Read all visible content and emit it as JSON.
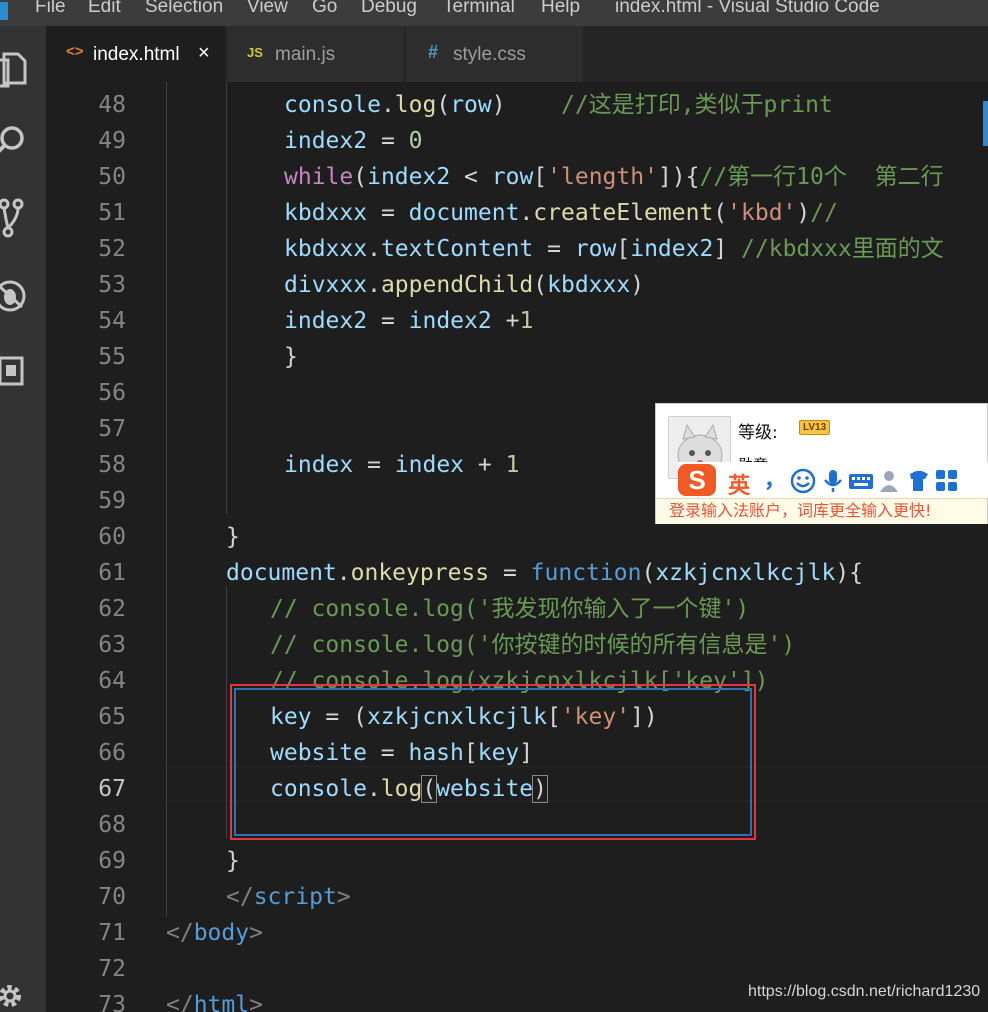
{
  "window": {
    "title": "index.html - Visual Studio Code"
  },
  "menu": [
    "File",
    "Edit",
    "Selection",
    "View",
    "Go",
    "Debug",
    "Terminal",
    "Help"
  ],
  "tabs": [
    {
      "icon": "<>",
      "label": "index.html",
      "close": "×",
      "active": true
    },
    {
      "icon": "JS",
      "label": "main.js",
      "active": false
    },
    {
      "icon": "#",
      "label": "style.css",
      "active": false
    }
  ],
  "current_line": "67",
  "lines": [
    {
      "n": "48",
      "tokens": [
        [
          "console",
          "var"
        ],
        [
          ".",
          "op"
        ],
        [
          "log",
          "fn"
        ],
        [
          "(",
          "op"
        ],
        [
          "row",
          "var"
        ],
        [
          ")",
          "op"
        ],
        [
          "    //这是打印,类似于print",
          "com"
        ]
      ]
    },
    {
      "n": "49",
      "tokens": [
        [
          "index2",
          "var"
        ],
        [
          " = ",
          "op"
        ],
        [
          "0",
          "num"
        ]
      ]
    },
    {
      "n": "50",
      "tokens": [
        [
          "while",
          "kw"
        ],
        [
          "(",
          "op"
        ],
        [
          "index2",
          "var"
        ],
        [
          " < ",
          "op"
        ],
        [
          "row",
          "var"
        ],
        [
          "[",
          "op"
        ],
        [
          "'length'",
          "str"
        ],
        [
          "]){",
          "op"
        ],
        [
          "//第一行10个  第二行",
          "com"
        ]
      ]
    },
    {
      "n": "51",
      "tokens": [
        [
          "kbdxxx",
          "var"
        ],
        [
          " = ",
          "op"
        ],
        [
          "document",
          "var"
        ],
        [
          ".",
          "op"
        ],
        [
          "createElement",
          "fn"
        ],
        [
          "(",
          "op"
        ],
        [
          "'kbd'",
          "str"
        ],
        [
          ")",
          "op"
        ],
        [
          "//",
          "com"
        ]
      ]
    },
    {
      "n": "52",
      "tokens": [
        [
          "kbdxxx",
          "var"
        ],
        [
          ".",
          "op"
        ],
        [
          "textContent",
          "var"
        ],
        [
          " = ",
          "op"
        ],
        [
          "row",
          "var"
        ],
        [
          "[",
          "op"
        ],
        [
          "index2",
          "var"
        ],
        [
          "] ",
          "op"
        ],
        [
          "//kbdxxx里面的文",
          "com"
        ]
      ]
    },
    {
      "n": "53",
      "tokens": [
        [
          "divxxx",
          "var"
        ],
        [
          ".",
          "op"
        ],
        [
          "appendChild",
          "fn"
        ],
        [
          "(",
          "op"
        ],
        [
          "kbdxxx",
          "var"
        ],
        [
          ")",
          "op"
        ]
      ]
    },
    {
      "n": "54",
      "tokens": [
        [
          "index2",
          "var"
        ],
        [
          " = ",
          "op"
        ],
        [
          "index2",
          "var"
        ],
        [
          " +",
          "op"
        ],
        [
          "1",
          "num"
        ]
      ]
    },
    {
      "n": "55",
      "tokens": [
        [
          "}",
          "op"
        ]
      ]
    },
    {
      "n": "56",
      "tokens": []
    },
    {
      "n": "57",
      "tokens": []
    },
    {
      "n": "58",
      "tokens": [
        [
          "index",
          "var"
        ],
        [
          " = ",
          "op"
        ],
        [
          "index",
          "var"
        ],
        [
          " + ",
          "op"
        ],
        [
          "1",
          "num"
        ]
      ]
    },
    {
      "n": "59",
      "tokens": []
    },
    {
      "n": "60",
      "tokens": [
        [
          "}",
          "op"
        ]
      ]
    },
    {
      "n": "61",
      "tokens": [
        [
          "document",
          "var"
        ],
        [
          ".",
          "op"
        ],
        [
          "onkeypress",
          "fn"
        ],
        [
          " = ",
          "op"
        ],
        [
          "function",
          "kw2"
        ],
        [
          "(",
          "op"
        ],
        [
          "xzkjcnxlkcjlk",
          "var"
        ],
        [
          "){",
          "op"
        ]
      ]
    },
    {
      "n": "62",
      "tokens": [
        [
          "// console.log('我发现你输入了一个键')",
          "com"
        ]
      ]
    },
    {
      "n": "63",
      "tokens": [
        [
          "// console.log('你按键的时候的所有信息是')",
          "com"
        ]
      ]
    },
    {
      "n": "64",
      "tokens": [
        [
          "// console.log(xzkjcnxlkcjlk['key'])",
          "com"
        ]
      ]
    },
    {
      "n": "65",
      "tokens": [
        [
          "key",
          "var"
        ],
        [
          " = (",
          "op"
        ],
        [
          "xzkjcnxlkcjlk",
          "var"
        ],
        [
          "[",
          "op"
        ],
        [
          "'key'",
          "str"
        ],
        [
          "])",
          "op"
        ]
      ]
    },
    {
      "n": "66",
      "tokens": [
        [
          "website",
          "var"
        ],
        [
          " = ",
          "op"
        ],
        [
          "hash",
          "var"
        ],
        [
          "[",
          "op"
        ],
        [
          "key",
          "var"
        ],
        [
          "]",
          "op"
        ]
      ]
    },
    {
      "n": "67",
      "tokens": [
        [
          "console",
          "var"
        ],
        [
          ".",
          "op"
        ],
        [
          "log",
          "fn"
        ],
        [
          "(",
          "bm"
        ],
        [
          "website",
          "var"
        ],
        [
          ")",
          "bm"
        ]
      ]
    },
    {
      "n": "68",
      "tokens": []
    },
    {
      "n": "69",
      "tokens": [
        [
          "}",
          "op"
        ]
      ]
    },
    {
      "n": "70",
      "tokens": [
        [
          "</",
          "punc"
        ],
        [
          "script",
          "tag"
        ],
        [
          ">",
          "punc"
        ]
      ]
    },
    {
      "n": "71",
      "tokens": [
        [
          "</",
          "punc"
        ],
        [
          "body",
          "tag"
        ],
        [
          ">",
          "punc"
        ]
      ]
    },
    {
      "n": "72",
      "tokens": []
    },
    {
      "n": "73",
      "tokens": [
        [
          "</",
          "punc"
        ],
        [
          "html",
          "tag"
        ],
        [
          ">",
          "punc"
        ]
      ]
    }
  ],
  "ime": {
    "level_label": "等级:",
    "level_badge": "LV13",
    "medal_label": "勋章",
    "logo_char": "S",
    "lang": "英",
    "punct": "，",
    "tip": "登录输入法账户，词库更全输入更快!"
  },
  "watermark": "https://blog.csdn.net/richard1230",
  "colors": {
    "accent": "#2a8cd2",
    "highlight_box": "#e5353d",
    "inner_box": "#2f6fb3",
    "ime_logo": "#f15a24",
    "ime_blue": "#1f6fd6"
  },
  "icons": [
    "explorer-icon",
    "search-icon",
    "source-control-icon",
    "debug-icon",
    "extensions-icon",
    "settings-gear-icon"
  ]
}
